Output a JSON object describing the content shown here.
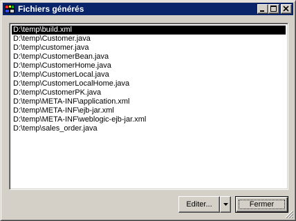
{
  "window": {
    "title": "Fichiers générés"
  },
  "titlebar_buttons": {
    "minimize": "minimize-icon",
    "maximize": "maximize-icon",
    "close": "close-icon"
  },
  "files": [
    "D:\\temp\\build.xml",
    "D:\\temp\\Customer.java",
    "D:\\temp\\customer.java",
    "D:\\temp\\CustomerBean.java",
    "D:\\temp\\CustomerHome.java",
    "D:\\temp\\CustomerLocal.java",
    "D:\\temp\\CustomerLocalHome.java",
    "D:\\temp\\CustomerPK.java",
    "D:\\temp\\META-INF\\application.xml",
    "D:\\temp\\META-INF\\ejb-jar.xml",
    "D:\\temp\\META-INF\\weblogic-ejb-jar.xml",
    "D:\\temp\\sales_order.java"
  ],
  "selected_index": 0,
  "buttons": {
    "edit_label": "Editer...",
    "close_label": "Fermer"
  },
  "colors": {
    "titlebar": "#0a246a",
    "selection": "#000000",
    "face": "#d4d0c8"
  }
}
